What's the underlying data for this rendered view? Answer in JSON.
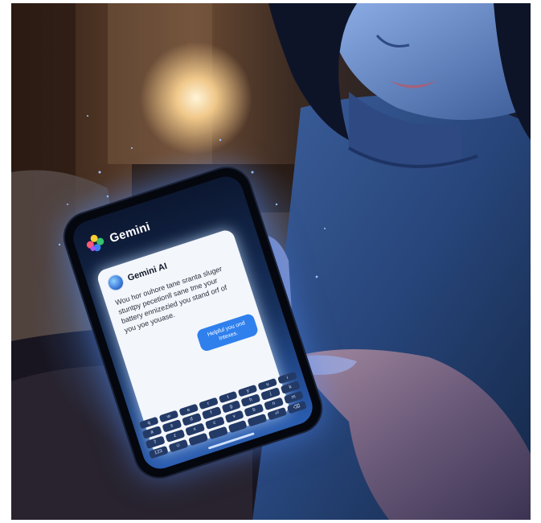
{
  "app": {
    "logo_icon": "gemini-sparkle-icon",
    "title": "Gemini"
  },
  "chat": {
    "sender_name": "Gemini AI",
    "avatar_icon": "bot-avatar-icon",
    "message": "Wou hor ouhore tane sranta sluger stuntpy pecetionll sane tme your battery ennizezied you stand orf of you yoe youase.",
    "reply": "Helpful you ond Intexes."
  },
  "keyboard": {
    "keys": [
      "q",
      "w",
      "e",
      "r",
      "t",
      "y",
      "u",
      "i",
      "a",
      "s",
      "d",
      "f",
      "g",
      "h",
      "j",
      "k",
      "⇧",
      "z",
      "x",
      "c",
      "v",
      "b",
      "n",
      "m",
      "123",
      "☺",
      " ",
      " ",
      " ",
      " ",
      "⏎",
      "⌫"
    ]
  },
  "colors": {
    "screen_glow": "#5a9cff",
    "accent": "#2f80ed",
    "card": "#f3f6fb"
  }
}
